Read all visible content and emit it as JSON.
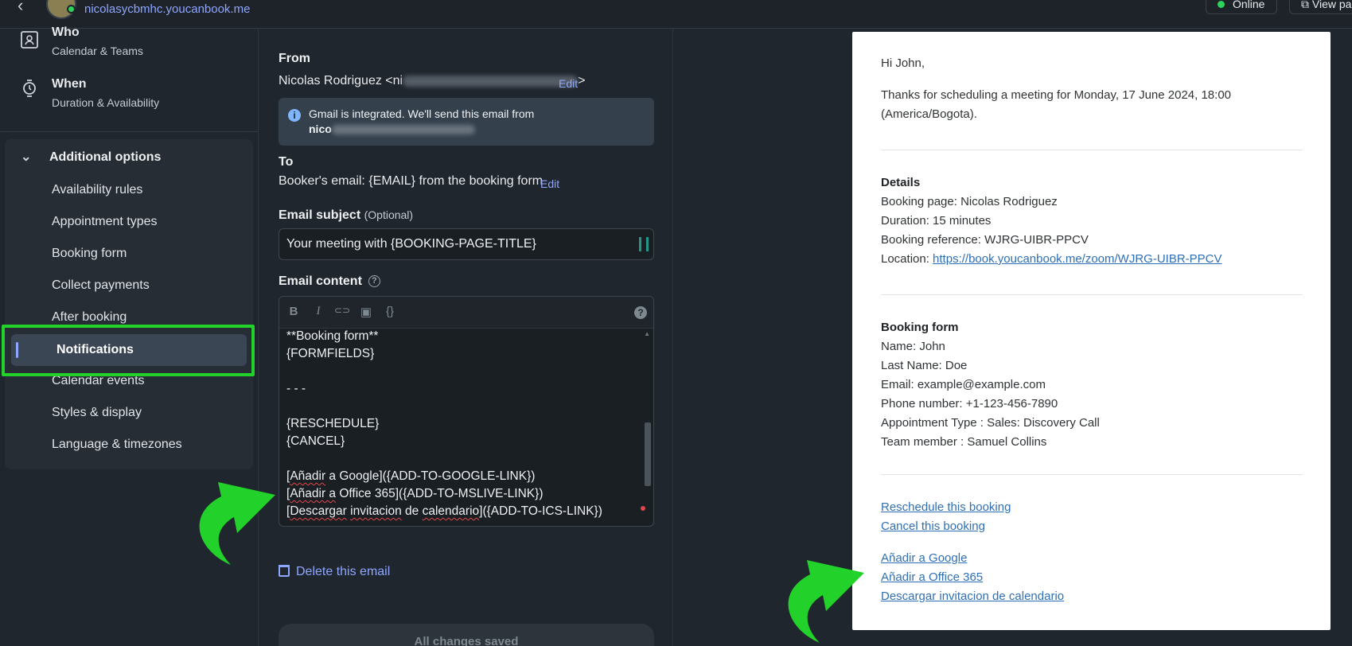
{
  "topbar": {
    "domain": "nicolasycbmhc.youcanbook.me",
    "status": "Online",
    "view_label": "View page"
  },
  "leftnav": {
    "steps": [
      {
        "title": "Who",
        "subtitle": "Calendar & Teams"
      },
      {
        "title": "When",
        "subtitle": "Duration & Availability"
      }
    ],
    "additional_header": "Additional options",
    "items": [
      {
        "label": "Availability rules"
      },
      {
        "label": "Appointment types"
      },
      {
        "label": "Booking form"
      },
      {
        "label": "Collect payments"
      },
      {
        "label": "After booking"
      },
      {
        "label": "Notifications"
      },
      {
        "label": "Calendar events"
      },
      {
        "label": "Styles & display"
      },
      {
        "label": "Language & timezones"
      }
    ]
  },
  "editor": {
    "from_label": "From",
    "from_name": "Nicolas Rodriguez <ni",
    "from_suffix": ">",
    "edit_label": "Edit",
    "info_line1": "Gmail is integrated. We'll send this email from",
    "info_line2": "nico",
    "to_label": "To",
    "to_value": "Booker's email: {EMAIL} from the booking form",
    "subject_label": "Email subject",
    "subject_optional": "(Optional)",
    "subject_value": "Your meeting with {BOOKING-PAGE-TITLE}",
    "content_label": "Email content",
    "toolbar": {
      "bold": "B",
      "italic": "I",
      "link": "⊂⊃",
      "image": "▣",
      "code": "{}",
      "help": "?"
    },
    "lines": [
      "**Booking form**",
      "{FORMFIELDS}",
      "",
      "- - -",
      "",
      "{RESCHEDULE}",
      "{CANCEL}",
      ""
    ],
    "link_lines": {
      "google_a": "Añadir",
      "google_b": " a Google]({ADD-TO-GOOGLE-LINK})",
      "office_a": "Añadir a",
      "office_b": " Office 365]({ADD-TO-MSLIVE-LINK})",
      "ics_a": "Descargar",
      "ics_b": " ",
      "ics_c": "invitacion",
      "ics_d": " de ",
      "ics_e": "calendario",
      "ics_f": "]({ADD-TO-ICS-LINK})"
    },
    "delete_label": "Delete this email",
    "save_status": "All changes saved"
  },
  "preview": {
    "greeting": "Hi John,",
    "intro": "Thanks for scheduling a meeting for Monday, 17 June 2024, 18:00",
    "intro_tz": "(America/Bogota).",
    "details_title": "Details",
    "details": [
      "Booking page: Nicolas Rodriguez",
      "Duration: 15 minutes",
      "Booking reference: WJRG-UIBR-PPCV"
    ],
    "location_label": "Location: ",
    "location_url": "https://book.youcanbook.me/zoom/WJRG-UIBR-PPCV",
    "form_title": "Booking form",
    "form_fields": [
      "Name: John",
      "Last Name: Doe",
      "Email: example@example.com",
      "Phone number: +1-123-456-7890",
      "Appointment Type : Sales: Discovery Call",
      "Team member : Samuel Collins"
    ],
    "reschedule": "Reschedule this booking",
    "cancel": "Cancel this booking",
    "add_google": "Añadir a Google",
    "add_office": "Añadir a Office 365",
    "download_ics": "Descargar invitacion de calendario"
  },
  "colors": {
    "background": "#20262d",
    "accent": "#8fa6ff",
    "highlight": "#22d12a",
    "link": "#2f6fb4"
  }
}
